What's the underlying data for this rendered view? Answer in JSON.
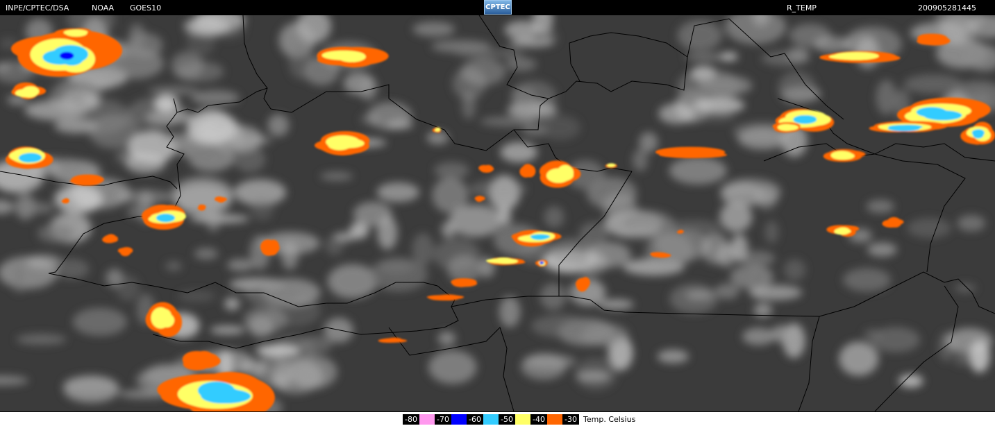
{
  "header": {
    "agency": "INPE/CPTEC/DSA",
    "provider": "NOAA",
    "satellite": "GOES10",
    "logo_text": "CPTEC",
    "product": "R_TEMP",
    "timestamp": "200905281445"
  },
  "legend": {
    "title": "Temp. Celsius",
    "items": [
      {
        "label": "-80",
        "color": "#ff99ee"
      },
      {
        "label": "-70",
        "color": "#0000ff"
      },
      {
        "label": "-60",
        "color": "#33ccff"
      },
      {
        "label": "-50",
        "color": "#ffff66"
      },
      {
        "label": "-40",
        "color": "#ff6600"
      },
      {
        "label": "-30",
        "color": null
      }
    ]
  },
  "map": {
    "type": "GOES infrared satellite image, South America",
    "colors": {
      "background": "#3a3a3a",
      "cloud_light": "#c8c8c8",
      "border": "#000000",
      "cold_orange": "#ff6600",
      "cold_yellow": "#ffff66",
      "cold_cyan": "#33ccff",
      "cold_blue": "#0000ff"
    }
  }
}
